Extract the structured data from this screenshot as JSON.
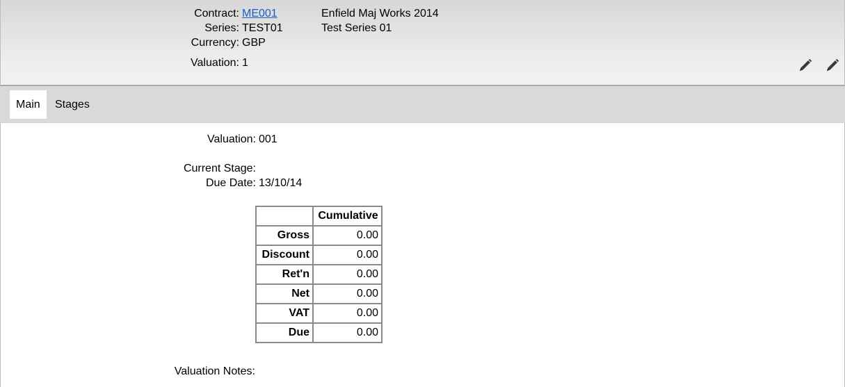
{
  "header": {
    "contract_label": "Contract:",
    "contract_value": "ME001",
    "contract_name": "Enfield Maj Works 2014",
    "series_label": "Series:",
    "series_value": "TEST01",
    "series_name": "Test Series 01",
    "currency_label": "Currency:",
    "currency_value": "GBP",
    "valuation_label": "Valuation:",
    "valuation_value": "1",
    "edit_icons": [
      "pencil-icon",
      "pencil-icon"
    ]
  },
  "tabs": [
    {
      "label": "Main",
      "active": true
    },
    {
      "label": "Stages",
      "active": false
    }
  ],
  "main": {
    "valuation_label": "Valuation:",
    "valuation_value": "001",
    "current_stage_label": "Current Stage:",
    "current_stage_value": "",
    "due_date_label": "Due Date:",
    "due_date_value": "13/10/14",
    "notes_label": "Valuation Notes:",
    "table": {
      "corner": "",
      "column_header": "Cumulative",
      "rows": [
        {
          "label": "Gross",
          "value": "0.00"
        },
        {
          "label": "Discount",
          "value": "0.00"
        },
        {
          "label": "Ret'n",
          "value": "0.00"
        },
        {
          "label": "Net",
          "value": "0.00"
        },
        {
          "label": "VAT",
          "value": "0.00"
        },
        {
          "label": "Due",
          "value": "0.00"
        }
      ]
    }
  },
  "colors": {
    "link": "#1a5ec6",
    "header_bg": "#e4e4e4",
    "tabbar_bg": "#d9d9d9",
    "table_border": "#8a8a8a"
  }
}
